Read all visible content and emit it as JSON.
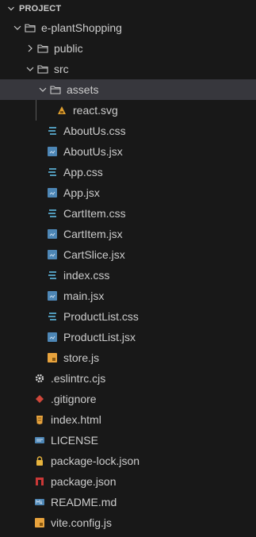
{
  "explorer": {
    "section_title": "PROJECT",
    "root": {
      "label": "e-plantShopping"
    },
    "public": {
      "label": "public"
    },
    "src": {
      "label": "src"
    },
    "assets": {
      "label": "assets"
    },
    "asset_files": [
      {
        "label": "react.svg",
        "icon": "react-svg-icon"
      }
    ],
    "src_files": [
      {
        "label": "AboutUs.css",
        "icon": "css-file-icon"
      },
      {
        "label": "AboutUs.jsx",
        "icon": "jsx-file-icon"
      },
      {
        "label": "App.css",
        "icon": "css-file-icon"
      },
      {
        "label": "App.jsx",
        "icon": "jsx-file-icon"
      },
      {
        "label": "CartItem.css",
        "icon": "css-file-icon"
      },
      {
        "label": "CartItem.jsx",
        "icon": "jsx-file-icon"
      },
      {
        "label": "CartSlice.jsx",
        "icon": "jsx-file-icon"
      },
      {
        "label": "index.css",
        "icon": "css-file-icon"
      },
      {
        "label": "main.jsx",
        "icon": "jsx-file-icon"
      },
      {
        "label": "ProductList.css",
        "icon": "css-file-icon"
      },
      {
        "label": "ProductList.jsx",
        "icon": "jsx-file-icon"
      },
      {
        "label": "store.js",
        "icon": "js-file-icon"
      }
    ],
    "root_files": [
      {
        "label": ".eslintrc.cjs",
        "icon": "eslint-gear-icon"
      },
      {
        "label": ".gitignore",
        "icon": "git-diamond-icon"
      },
      {
        "label": "index.html",
        "icon": "html-file-icon"
      },
      {
        "label": "LICENSE",
        "icon": "license-file-icon"
      },
      {
        "label": "package-lock.json",
        "icon": "lock-json-icon"
      },
      {
        "label": "package.json",
        "icon": "npm-package-icon"
      },
      {
        "label": "README.md",
        "icon": "markdown-file-icon"
      },
      {
        "label": "vite.config.js",
        "icon": "js-file-icon"
      }
    ]
  },
  "colors": {
    "background": "#181818",
    "selected_row": "#37373d",
    "text": "#cccccc",
    "css_icon": "#519aba",
    "jsx_icon": "#4d86b5",
    "js_icon": "#e8a33d",
    "react_svg_icon": "#e0a02f",
    "git_icon": "#d0473a",
    "npm_icon": "#cb3837",
    "html_icon": "#e8a33d",
    "md_icon": "#4d86b5",
    "license_icon": "#4d86b5"
  }
}
